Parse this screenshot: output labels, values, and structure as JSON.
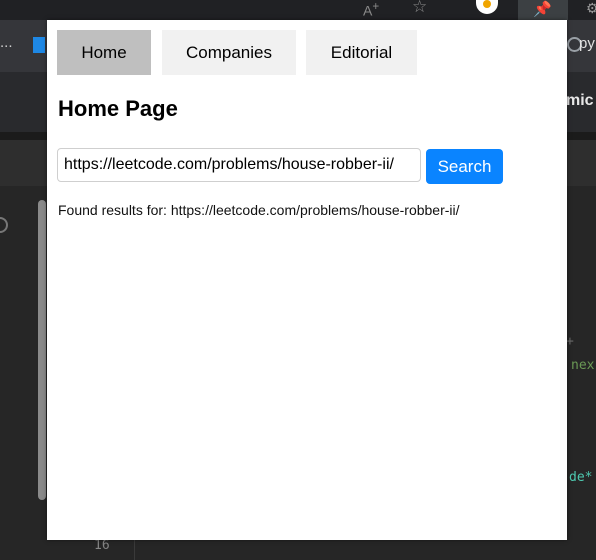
{
  "popup": {
    "tabs": [
      {
        "label": "Home",
        "active": true
      },
      {
        "label": "Companies",
        "active": false
      },
      {
        "label": "Editorial",
        "active": false
      }
    ],
    "page_title": "Home Page",
    "search": {
      "value": "https://leetcode.com/problems/house-robber-ii/",
      "button_label": "Search"
    },
    "results": {
      "prefix": "Found results for: ",
      "url": "https://leetcode.com/problems/house-robber-ii/"
    }
  },
  "background": {
    "bookmarks": {
      "ellipsis": "...",
      "py_label": "py"
    },
    "header_text": "mic",
    "code_fragments": {
      "plus": "+",
      "nex": "nex",
      "de": "de*"
    },
    "line_number": "16"
  },
  "colors": {
    "accent": "#0a84ff",
    "tab_active": "#bfbfbf",
    "tab_inactive": "#f1f1f1",
    "chrome_bg": "#202124"
  }
}
